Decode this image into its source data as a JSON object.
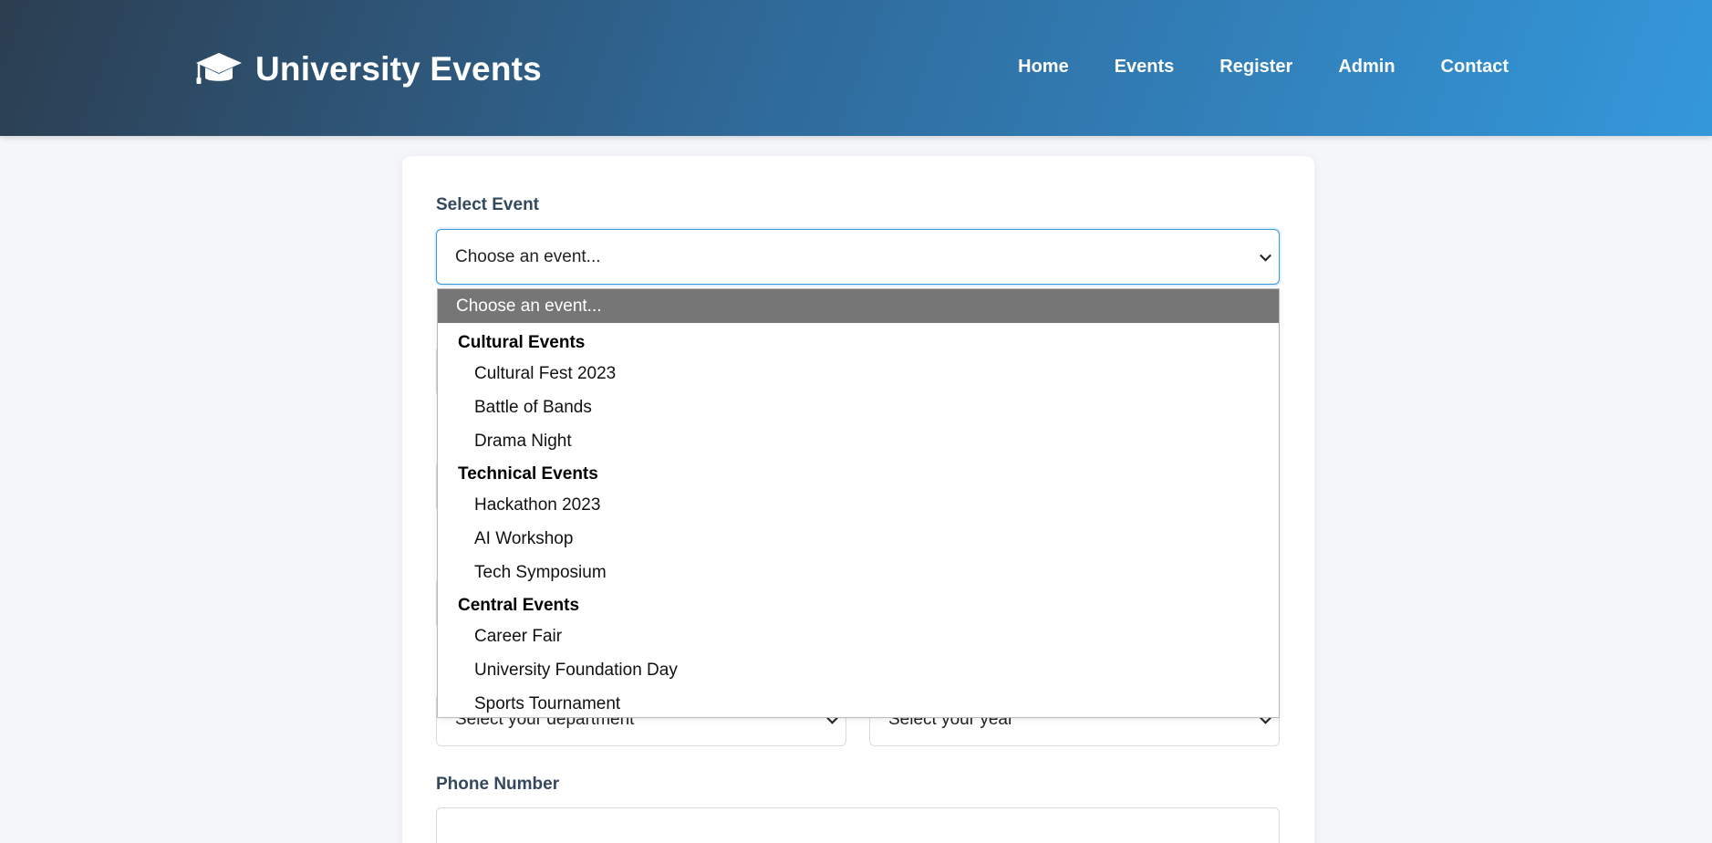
{
  "header": {
    "brand": "University Events",
    "nav": [
      "Home",
      "Events",
      "Register",
      "Admin",
      "Contact"
    ]
  },
  "form": {
    "select_event_label": "Select Event",
    "select_event_value": "Choose an event...",
    "department_placeholder": "Select your department",
    "year_placeholder": "Select your year",
    "phone_label": "Phone Number"
  },
  "dropdown": {
    "selected": "Choose an event...",
    "groups": [
      {
        "label": "Cultural Events",
        "options": [
          "Cultural Fest 2023",
          "Battle of Bands",
          "Drama Night"
        ]
      },
      {
        "label": "Technical Events",
        "options": [
          "Hackathon 2023",
          "AI Workshop",
          "Tech Symposium"
        ]
      },
      {
        "label": "Central Events",
        "options": [
          "Career Fair",
          "University Foundation Day",
          "Sports Tournament"
        ]
      }
    ]
  },
  "colors": {
    "header_gradient_start": "#2c3e50",
    "header_gradient_end": "#3498db",
    "focus_border": "#3498db",
    "selected_option_bg": "#767676"
  },
  "icons": {
    "brand": "graduation-cap-icon"
  }
}
